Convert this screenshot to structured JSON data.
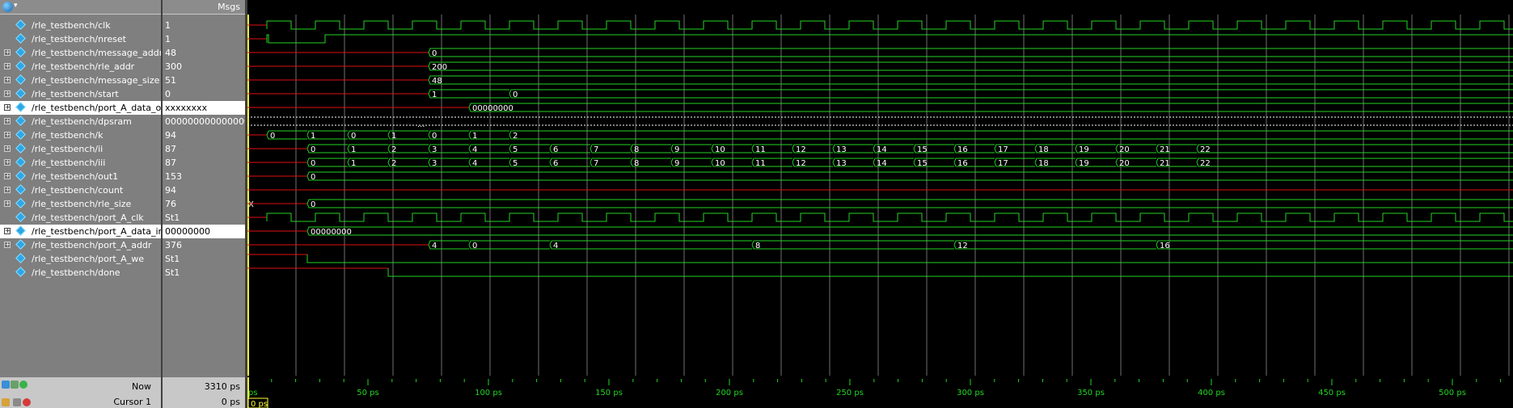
{
  "header": {
    "msgs_label": "Msgs"
  },
  "signals": [
    {
      "name": "/rle_testbench/clk",
      "value": "1",
      "expandable": false,
      "selected": false
    },
    {
      "name": "/rle_testbench/nreset",
      "value": "1",
      "expandable": false,
      "selected": false
    },
    {
      "name": "/rle_testbench/message_addr",
      "value": "48",
      "expandable": true,
      "selected": false
    },
    {
      "name": "/rle_testbench/rle_addr",
      "value": "300",
      "expandable": true,
      "selected": false
    },
    {
      "name": "/rle_testbench/message_size",
      "value": "51",
      "expandable": true,
      "selected": false
    },
    {
      "name": "/rle_testbench/start",
      "value": "0",
      "expandable": true,
      "selected": false
    },
    {
      "name": "/rle_testbench/port_A_data_out",
      "value": "xxxxxxxx",
      "expandable": true,
      "selected": true
    },
    {
      "name": "/rle_testbench/dpsram",
      "value": "0000000000000000",
      "expandable": true,
      "selected": false
    },
    {
      "name": "/rle_testbench/k",
      "value": "94",
      "expandable": true,
      "selected": false
    },
    {
      "name": "/rle_testbench/ii",
      "value": "87",
      "expandable": true,
      "selected": false
    },
    {
      "name": "/rle_testbench/iii",
      "value": "87",
      "expandable": true,
      "selected": false
    },
    {
      "name": "/rle_testbench/out1",
      "value": "153",
      "expandable": true,
      "selected": false
    },
    {
      "name": "/rle_testbench/count",
      "value": "94",
      "expandable": true,
      "selected": false
    },
    {
      "name": "/rle_testbench/rle_size",
      "value": "76",
      "expandable": true,
      "selected": false
    },
    {
      "name": "/rle_testbench/port_A_clk",
      "value": "St1",
      "expandable": false,
      "selected": false
    },
    {
      "name": "/rle_testbench/port_A_data_in",
      "value": "00000000",
      "expandable": true,
      "selected": true
    },
    {
      "name": "/rle_testbench/port_A_addr",
      "value": "376",
      "expandable": true,
      "selected": false
    },
    {
      "name": "/rle_testbench/port_A_we",
      "value": "St1",
      "expandable": false,
      "selected": false
    },
    {
      "name": "/rle_testbench/done",
      "value": "St1",
      "expandable": false,
      "selected": false
    }
  ],
  "wave_labels": {
    "message_addr": "0",
    "rle_addr": "200",
    "message_size": "48",
    "start": [
      "1",
      "0"
    ],
    "port_A_data_out": "00000000",
    "dpsram_dots": "...",
    "k": [
      "0",
      "1",
      "0",
      "1",
      "0",
      "1",
      "2"
    ],
    "ii": [
      "0",
      "1",
      "2",
      "3",
      "4",
      "5",
      "6",
      "7",
      "8",
      "9",
      "10",
      "11",
      "12",
      "13",
      "14",
      "15",
      "16",
      "17",
      "18",
      "19",
      "20",
      "21",
      "22"
    ],
    "out1": "0",
    "rle_size": [
      "X",
      "0"
    ],
    "port_A_data_in": "00000000",
    "port_A_addr": [
      "4",
      "0",
      "4",
      "8",
      "12",
      "16"
    ]
  },
  "timeline": {
    "ticks": [
      "ps",
      "50 ps",
      "100 ps",
      "150 ps",
      "200 ps",
      "250 ps",
      "300 ps",
      "350 ps",
      "400 ps",
      "450 ps",
      "500 ps"
    ],
    "cursor_label": "0 ps"
  },
  "footer": {
    "now_label": "Now",
    "now_value": "3310 ps",
    "cursor_name": "Cursor 1",
    "cursor_value": "0 ps"
  },
  "colors": {
    "wave": "#22d422",
    "undef": "#e01010",
    "cursor": "#ffff33",
    "grid": "#707070",
    "ticks": "#22d422"
  }
}
